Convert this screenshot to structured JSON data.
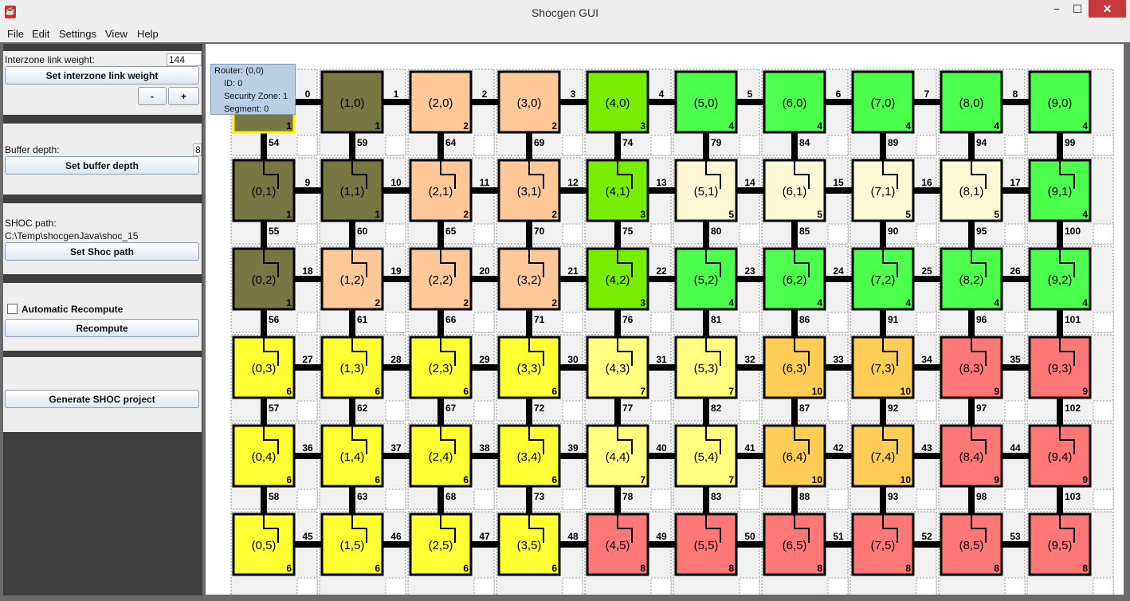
{
  "window": {
    "title": "Shocgen GUI",
    "controls": {
      "minimize": "−",
      "maximize": "☐",
      "close": "✕"
    }
  },
  "menu": [
    "File",
    "Edit",
    "Settings",
    "View",
    "Help"
  ],
  "sidebar": {
    "interzone_label": "Interzone link weight:",
    "interzone_value": "144",
    "set_interzone_button": "Set interzone link weight",
    "minus_button": "-",
    "plus_button": "+",
    "buffer_label": "Buffer depth:",
    "buffer_value": "8",
    "set_buffer_button": "Set buffer depth",
    "shoc_path_label": "SHOC path:",
    "shoc_path_value": "C:\\Temp\\shocgenJava\\shoc_15",
    "set_shoc_button": "Set Shoc path",
    "auto_recompute_label": "Automatic Recompute",
    "auto_recompute_checked": false,
    "recompute_button": "Recompute",
    "generate_button": "Generate SHOC project"
  },
  "tooltip": {
    "router": "Router: (0,0)",
    "id": "ID: 0",
    "zone": "Security Zone: 1",
    "segment": "Segment: 0"
  },
  "zone_colors": {
    "1": "#777744",
    "2": "#ffc898",
    "3": "#77ee00",
    "4": "#4cff4c",
    "5": "#fff8d4",
    "6": "#ffff33",
    "7": "#ffff80",
    "8": "#ff7777",
    "9": "#ff7777",
    "10": "#ffcc55"
  },
  "grid": {
    "cols": 10,
    "rows": 6,
    "selected": "0,0",
    "zones": [
      [
        1,
        1,
        2,
        2,
        3,
        4,
        4,
        4,
        4,
        4
      ],
      [
        1,
        1,
        2,
        2,
        3,
        5,
        5,
        5,
        5,
        4
      ],
      [
        1,
        2,
        2,
        2,
        3,
        4,
        4,
        4,
        4,
        4
      ],
      [
        6,
        6,
        6,
        6,
        7,
        7,
        10,
        10,
        9,
        9
      ],
      [
        6,
        6,
        6,
        6,
        7,
        7,
        10,
        10,
        9,
        9
      ],
      [
        6,
        6,
        6,
        6,
        8,
        8,
        8,
        8,
        8,
        8
      ]
    ],
    "horizontal_links": [
      [
        0,
        1,
        2,
        3,
        4,
        5,
        6,
        7,
        8
      ],
      [
        9,
        10,
        11,
        12,
        13,
        14,
        15,
        16,
        17
      ],
      [
        18,
        19,
        20,
        21,
        22,
        23,
        24,
        25,
        26
      ],
      [
        27,
        28,
        29,
        30,
        31,
        32,
        33,
        34,
        35
      ],
      [
        36,
        37,
        38,
        39,
        40,
        41,
        42,
        43,
        44
      ],
      [
        45,
        46,
        47,
        48,
        49,
        50,
        51,
        52,
        53
      ]
    ],
    "vertical_links": [
      [
        54,
        59,
        64,
        69,
        74,
        79,
        84,
        89,
        94,
        99
      ],
      [
        55,
        60,
        65,
        70,
        75,
        80,
        85,
        90,
        95,
        100
      ],
      [
        56,
        61,
        66,
        71,
        76,
        81,
        86,
        91,
        96,
        101
      ],
      [
        57,
        62,
        67,
        72,
        77,
        82,
        87,
        92,
        97,
        102
      ],
      [
        58,
        63,
        68,
        73,
        78,
        83,
        88,
        93,
        98,
        103
      ]
    ]
  }
}
